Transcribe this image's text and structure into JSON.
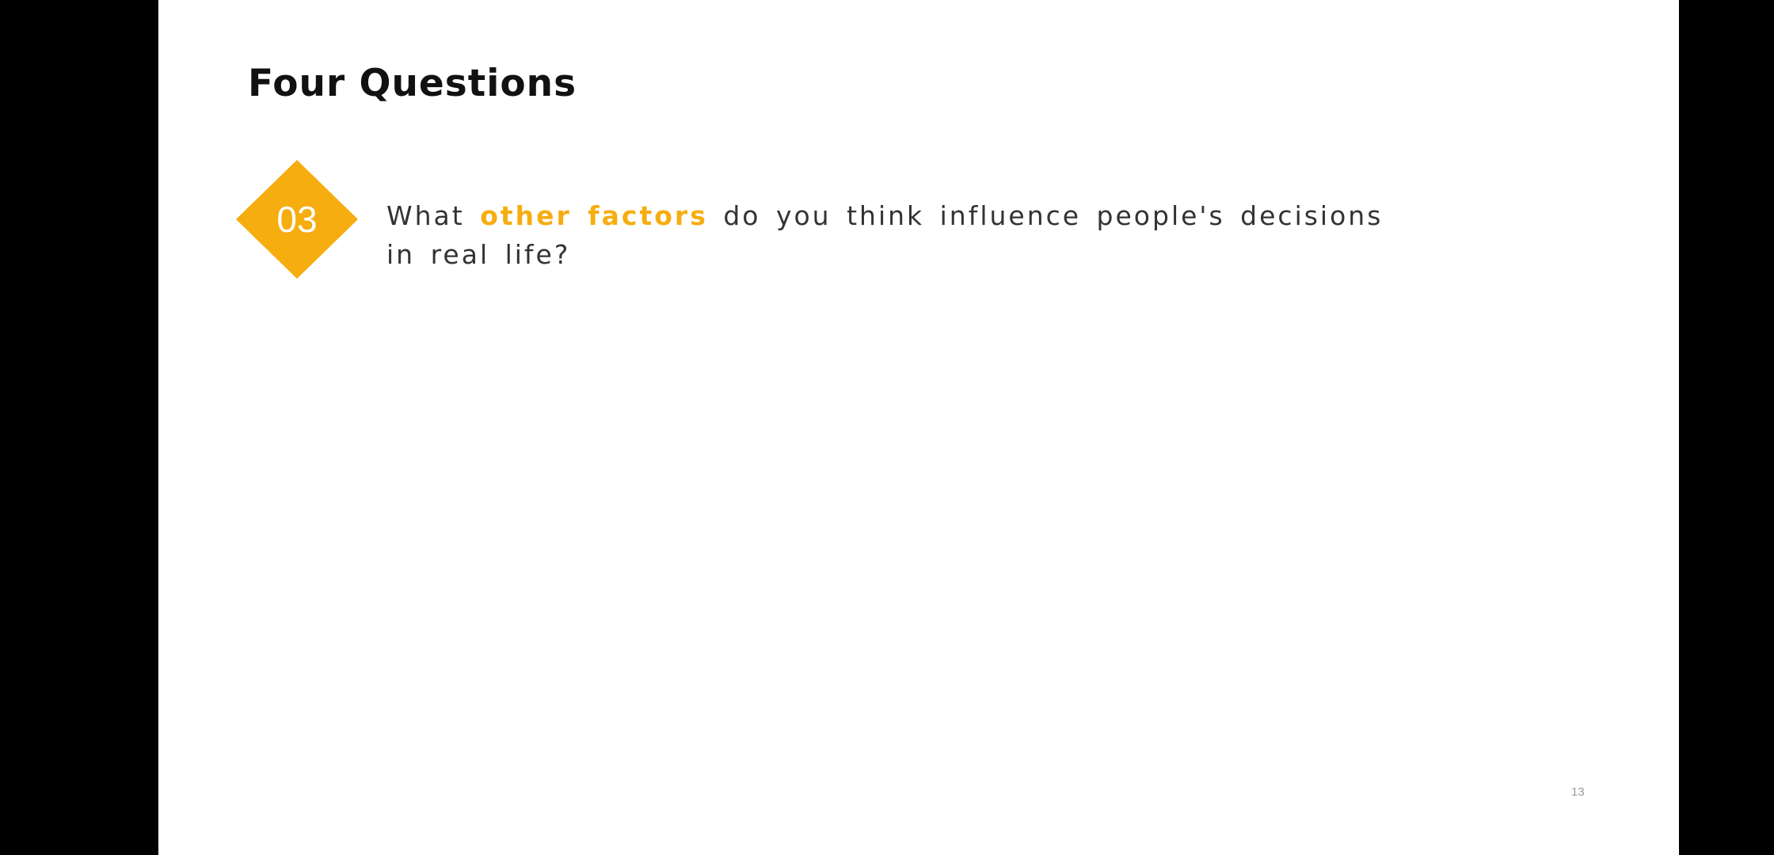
{
  "slide": {
    "title": "Four Questions",
    "question": {
      "number": "03",
      "text_before": "What ",
      "highlight": "other factors",
      "text_after": " do you think influence people's decisions in real life?"
    },
    "page_number": "13"
  },
  "colors": {
    "accent": "#f6ad10",
    "background": "#ffffff",
    "frame": "#000000",
    "text": "#333333"
  },
  "icons": {
    "badge_shape": "diamond"
  }
}
